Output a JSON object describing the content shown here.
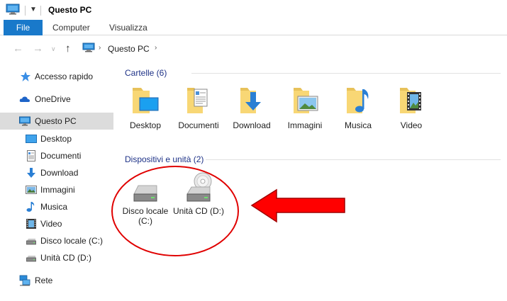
{
  "window": {
    "title": "Questo PC"
  },
  "ribbon": {
    "tabs": [
      {
        "label": "File"
      },
      {
        "label": "Computer"
      },
      {
        "label": "Visualizza"
      }
    ]
  },
  "address": {
    "path": "Questo PC"
  },
  "sidebar": {
    "items": [
      {
        "label": "Accesso rapido",
        "icon": "star-icon"
      },
      {
        "label": "OneDrive",
        "icon": "cloud-icon"
      },
      {
        "label": "Questo PC",
        "icon": "computer-icon",
        "selected": true
      },
      {
        "label": "Desktop",
        "icon": "desktop-icon"
      },
      {
        "label": "Documenti",
        "icon": "document-icon"
      },
      {
        "label": "Download",
        "icon": "download-icon"
      },
      {
        "label": "Immagini",
        "icon": "pictures-icon"
      },
      {
        "label": "Musica",
        "icon": "music-icon"
      },
      {
        "label": "Video",
        "icon": "video-icon"
      },
      {
        "label": "Disco locale (C:)",
        "icon": "hard-drive-icon"
      },
      {
        "label": "Unità CD (D:)",
        "icon": "cd-drive-icon"
      },
      {
        "label": "Rete",
        "icon": "network-icon"
      }
    ]
  },
  "main": {
    "folders_header": "Cartelle (6)",
    "folders": [
      {
        "label": "Desktop",
        "icon": "desktop-folder-icon"
      },
      {
        "label": "Documenti",
        "icon": "documents-folder-icon"
      },
      {
        "label": "Download",
        "icon": "download-folder-icon"
      },
      {
        "label": "Immagini",
        "icon": "pictures-folder-icon"
      },
      {
        "label": "Musica",
        "icon": "music-folder-icon"
      },
      {
        "label": "Video",
        "icon": "video-folder-icon"
      }
    ],
    "devices_header": "Dispositivi e unità (2)",
    "devices": [
      {
        "label_line1": "Disco locale",
        "label_line2": "(C:)",
        "icon": "hard-drive-icon"
      },
      {
        "label_line1": "Unità CD (D:)",
        "label_line2": "",
        "icon": "cd-drive-icon"
      }
    ]
  },
  "colors": {
    "accent": "#1979ca",
    "section_header": "#1e3287",
    "annotation_red": "#e00000",
    "folder_yellow": "#f8d775"
  }
}
